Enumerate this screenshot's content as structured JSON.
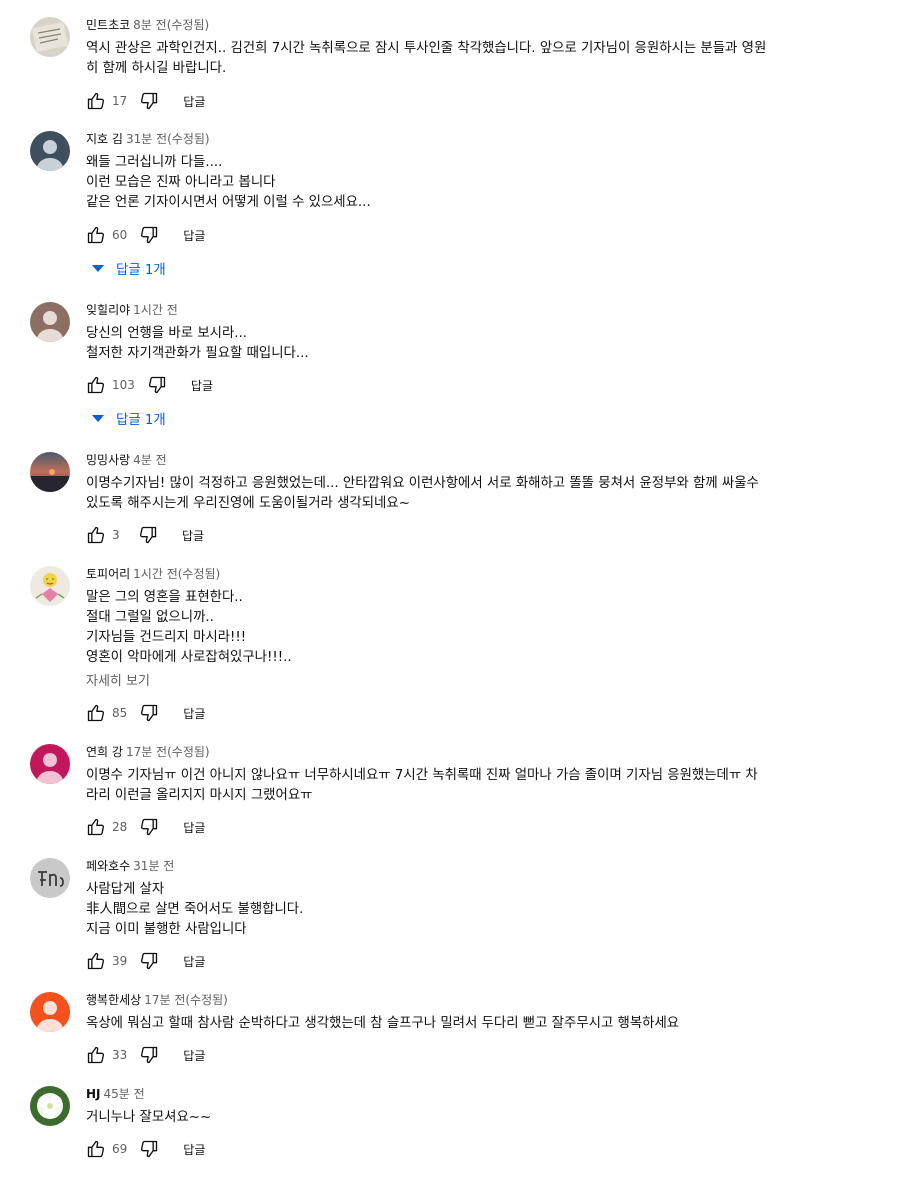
{
  "reply_label": "답글",
  "more_label": "자세히 보기",
  "comments": [
    {
      "author": "민트초코",
      "time": "8분 전(수정됨)",
      "text": "역시 관상은 과학인건지.. 김건희 7시간 녹취록으로 잠시 투사인줄 착각했습니다.  앞으로 기자님이 응원하시는 분들과 영원\n히 함께 하시길 바랍니다.",
      "likes": "17"
    },
    {
      "author": "지호 김",
      "time": "31분 전(수정됨)",
      "text": "왜들 그러십니까 다들....\n이런 모습은 진짜 아니라고 봅니다\n같은 언론 기자이시면서 어떻게 이럴 수 있으세요...",
      "likes": "60",
      "replies": "답글 1개"
    },
    {
      "author": "잊힐리야",
      "time": "1시간 전",
      "text": "당신의 언행을 바로 보시라...\n철저한 자기객관화가 필요할 때입니다...",
      "likes": "103",
      "replies": "답글 1개"
    },
    {
      "author": "밍밍사랑",
      "time": "4분 전",
      "text": "이명수기자님! 많이 걱정하고 응원했었는데... 안타깝워요  이런사항에서 서로 화해하고 똘똘 뭉쳐서 윤정부와 함께 싸울수\n있도록 해주시는게 우리진영에 도움이될거라 생각되네요~",
      "likes": "3"
    },
    {
      "author": "토피어리",
      "time": "1시간 전(수정됨)",
      "text": "말은 그의 영혼을 표현한다..\n절대 그럴일 없으니까..\n기자님들 건드리지 마시라!!!\n영혼이 악마에게 사로잡혀있구나!!!..",
      "likes": "85",
      "more": true
    },
    {
      "author": "연희 강",
      "time": "17분 전(수정됨)",
      "text": "이명수 기자님ㅠ 이건 아니지 않나요ㅠ 너무하시네요ㅠ 7시간 녹취록때 진짜 얼마나 가슴 졸이며 기자님 응원했는데ㅠ 차\n라리 이런글 올리지지 마시지 그랬어요ㅠ",
      "likes": "28"
    },
    {
      "author": "페와호수",
      "time": "31분 전",
      "text": "사람답게 살자\n非人間으로 살면 죽어서도 불행합니다.\n지금 이미 불행한 사람입니다",
      "likes": "39"
    },
    {
      "author": "행복한세상",
      "time": "17분 전(수정됨)",
      "text": "옥상에 뭐심고 할때 참사람 순박하다고 생각했는데  참 슬프구나  밀려서  두다리 뻗고 잘주무시고  행복하세요",
      "likes": "33"
    },
    {
      "author": "HJ",
      "time": "45분 전",
      "text": "거니누나 잘모셔요~~",
      "likes": "69"
    }
  ]
}
